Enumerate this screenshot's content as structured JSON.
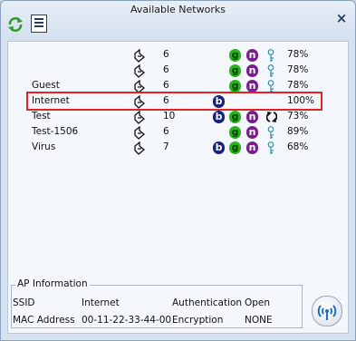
{
  "window": {
    "title": "Available Networks",
    "close_glyph": "×"
  },
  "toolbar": {
    "refresh_icon": "refresh-icon",
    "list_icon": "list-view-icon"
  },
  "networks": [
    {
      "ssid": "",
      "channel": "6",
      "b": false,
      "g": true,
      "n": true,
      "secured": true,
      "signal": "78%",
      "selected": false
    },
    {
      "ssid": "",
      "channel": "6",
      "b": false,
      "g": true,
      "n": true,
      "secured": true,
      "signal": "78%",
      "selected": false
    },
    {
      "ssid": "Guest",
      "channel": "6",
      "b": false,
      "g": true,
      "n": true,
      "secured": true,
      "signal": "78%",
      "selected": false
    },
    {
      "ssid": "Internet",
      "channel": "6",
      "b": true,
      "g": false,
      "n": false,
      "secured": false,
      "signal": "100%",
      "selected": true
    },
    {
      "ssid": "Test",
      "channel": "10",
      "b": true,
      "g": true,
      "n": true,
      "secured": false,
      "wps": true,
      "signal": "73%",
      "selected": false
    },
    {
      "ssid": "Test-1506",
      "channel": "6",
      "b": false,
      "g": true,
      "n": true,
      "secured": true,
      "signal": "89%",
      "selected": false
    },
    {
      "ssid": "Virus",
      "channel": "7",
      "b": true,
      "g": true,
      "n": true,
      "secured": true,
      "signal": "68%",
      "selected": false
    }
  ],
  "ap_info": {
    "legend": "AP Information",
    "ssid_label": "SSID",
    "ssid_value": "Internet",
    "auth_label": "Authentication",
    "auth_value": "Open",
    "mac_label": "MAC Address",
    "mac_value": "00-11-22-33-44-00",
    "enc_label": "Encryption",
    "enc_value": "NONE"
  },
  "badges": {
    "b": "b",
    "g": "g",
    "n": "n"
  },
  "colors": {
    "selection_outline": "#e02424",
    "badge_b": "#16237a",
    "badge_g": "#29b31c",
    "badge_n": "#7a1f8a"
  }
}
